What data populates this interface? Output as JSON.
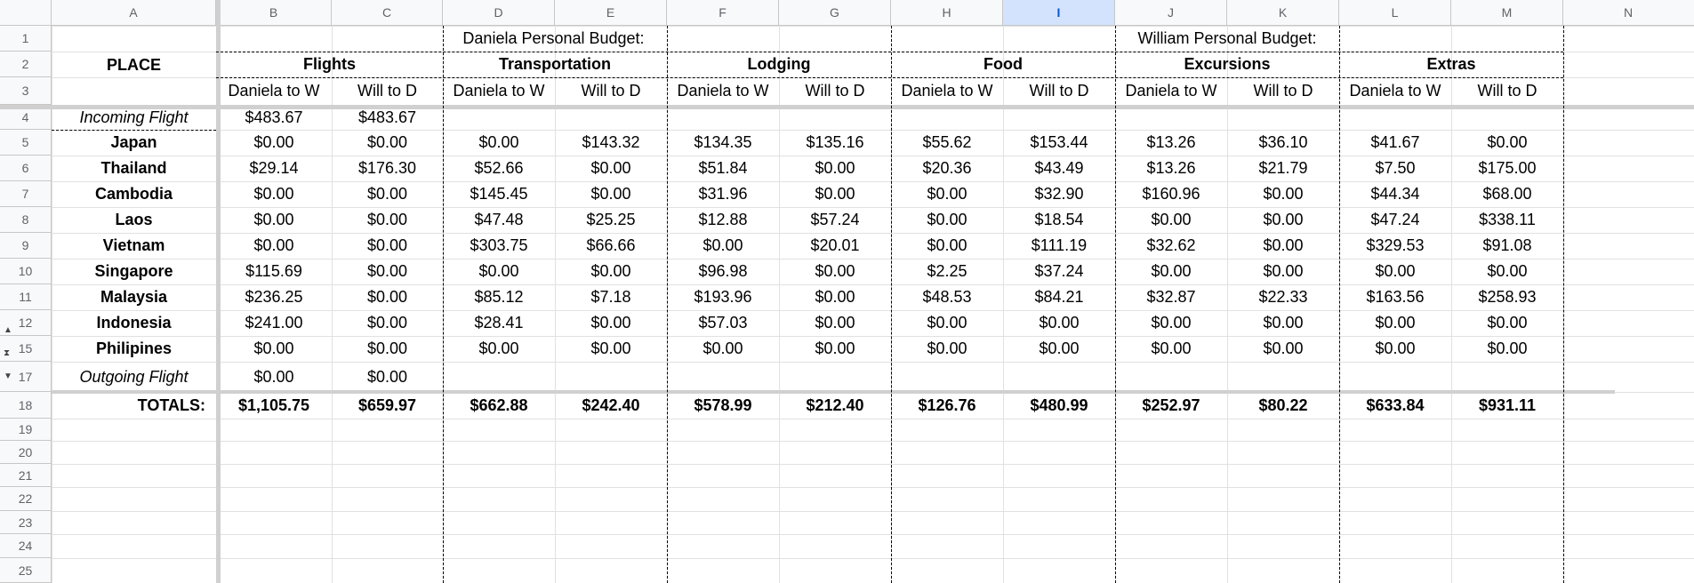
{
  "columns": [
    "A",
    "B",
    "C",
    "D",
    "E",
    "F",
    "G",
    "H",
    "I",
    "J",
    "K",
    "L",
    "M",
    "N"
  ],
  "selected_column": "I",
  "row_numbers": [
    "1",
    "2",
    "3",
    "4",
    "5",
    "6",
    "7",
    "8",
    "9",
    "10",
    "11",
    "12",
    "15",
    "17",
    "18",
    "19",
    "20",
    "21",
    "22",
    "23",
    "24",
    "25"
  ],
  "header": {
    "place": "PLACE",
    "daniela_budget": "Daniela Personal Budget:",
    "william_budget": "William Personal Budget:",
    "categories": [
      "Flights",
      "Transportation",
      "Lodging",
      "Food",
      "Excursions",
      "Extras"
    ],
    "sub_daniela": "Daniela to W",
    "sub_will": "Will to D"
  },
  "rows": [
    {
      "place": "Incoming Flight",
      "italic": true,
      "values": [
        "$483.67",
        "$483.67",
        "",
        "",
        "",
        "",
        "",
        "",
        "",
        "",
        "",
        ""
      ]
    },
    {
      "place": "Japan",
      "values": [
        "$0.00",
        "$0.00",
        "$0.00",
        "$143.32",
        "$134.35",
        "$135.16",
        "$55.62",
        "$153.44",
        "$13.26",
        "$36.10",
        "$41.67",
        "$0.00"
      ]
    },
    {
      "place": "Thailand",
      "values": [
        "$29.14",
        "$176.30",
        "$52.66",
        "$0.00",
        "$51.84",
        "$0.00",
        "$20.36",
        "$43.49",
        "$13.26",
        "$21.79",
        "$7.50",
        "$175.00"
      ]
    },
    {
      "place": "Cambodia",
      "values": [
        "$0.00",
        "$0.00",
        "$145.45",
        "$0.00",
        "$31.96",
        "$0.00",
        "$0.00",
        "$32.90",
        "$160.96",
        "$0.00",
        "$44.34",
        "$68.00"
      ]
    },
    {
      "place": "Laos",
      "values": [
        "$0.00",
        "$0.00",
        "$47.48",
        "$25.25",
        "$12.88",
        "$57.24",
        "$0.00",
        "$18.54",
        "$0.00",
        "$0.00",
        "$47.24",
        "$338.11"
      ]
    },
    {
      "place": "Vietnam",
      "values": [
        "$0.00",
        "$0.00",
        "$303.75",
        "$66.66",
        "$0.00",
        "$20.01",
        "$0.00",
        "$111.19",
        "$32.62",
        "$0.00",
        "$329.53",
        "$91.08"
      ]
    },
    {
      "place": "Singapore",
      "values": [
        "$115.69",
        "$0.00",
        "$0.00",
        "$0.00",
        "$96.98",
        "$0.00",
        "$2.25",
        "$37.24",
        "$0.00",
        "$0.00",
        "$0.00",
        "$0.00"
      ]
    },
    {
      "place": "Malaysia",
      "values": [
        "$236.25",
        "$0.00",
        "$85.12",
        "$7.18",
        "$193.96",
        "$0.00",
        "$48.53",
        "$84.21",
        "$32.87",
        "$22.33",
        "$163.56",
        "$258.93"
      ]
    },
    {
      "place": "Indonesia",
      "values": [
        "$241.00",
        "$0.00",
        "$28.41",
        "$0.00",
        "$57.03",
        "$0.00",
        "$0.00",
        "$0.00",
        "$0.00",
        "$0.00",
        "$0.00",
        "$0.00"
      ]
    },
    {
      "place": "Philipines",
      "values": [
        "$0.00",
        "$0.00",
        "$0.00",
        "$0.00",
        "$0.00",
        "$0.00",
        "$0.00",
        "$0.00",
        "$0.00",
        "$0.00",
        "$0.00",
        "$0.00"
      ]
    },
    {
      "place": "Outgoing Flight",
      "italic": true,
      "values": [
        "$0.00",
        "$0.00",
        "",
        "",
        "",
        "",
        "",
        "",
        "",
        "",
        "",
        ""
      ]
    }
  ],
  "totals": {
    "label": "TOTALS:",
    "values": [
      "$1,105.75",
      "$659.97",
      "$662.88",
      "$242.40",
      "$578.99",
      "$212.40",
      "$126.76",
      "$480.99",
      "$252.97",
      "$80.22",
      "$633.84",
      "$931.11"
    ]
  },
  "group_controls": [
    "▲",
    "⧗",
    "▼"
  ]
}
